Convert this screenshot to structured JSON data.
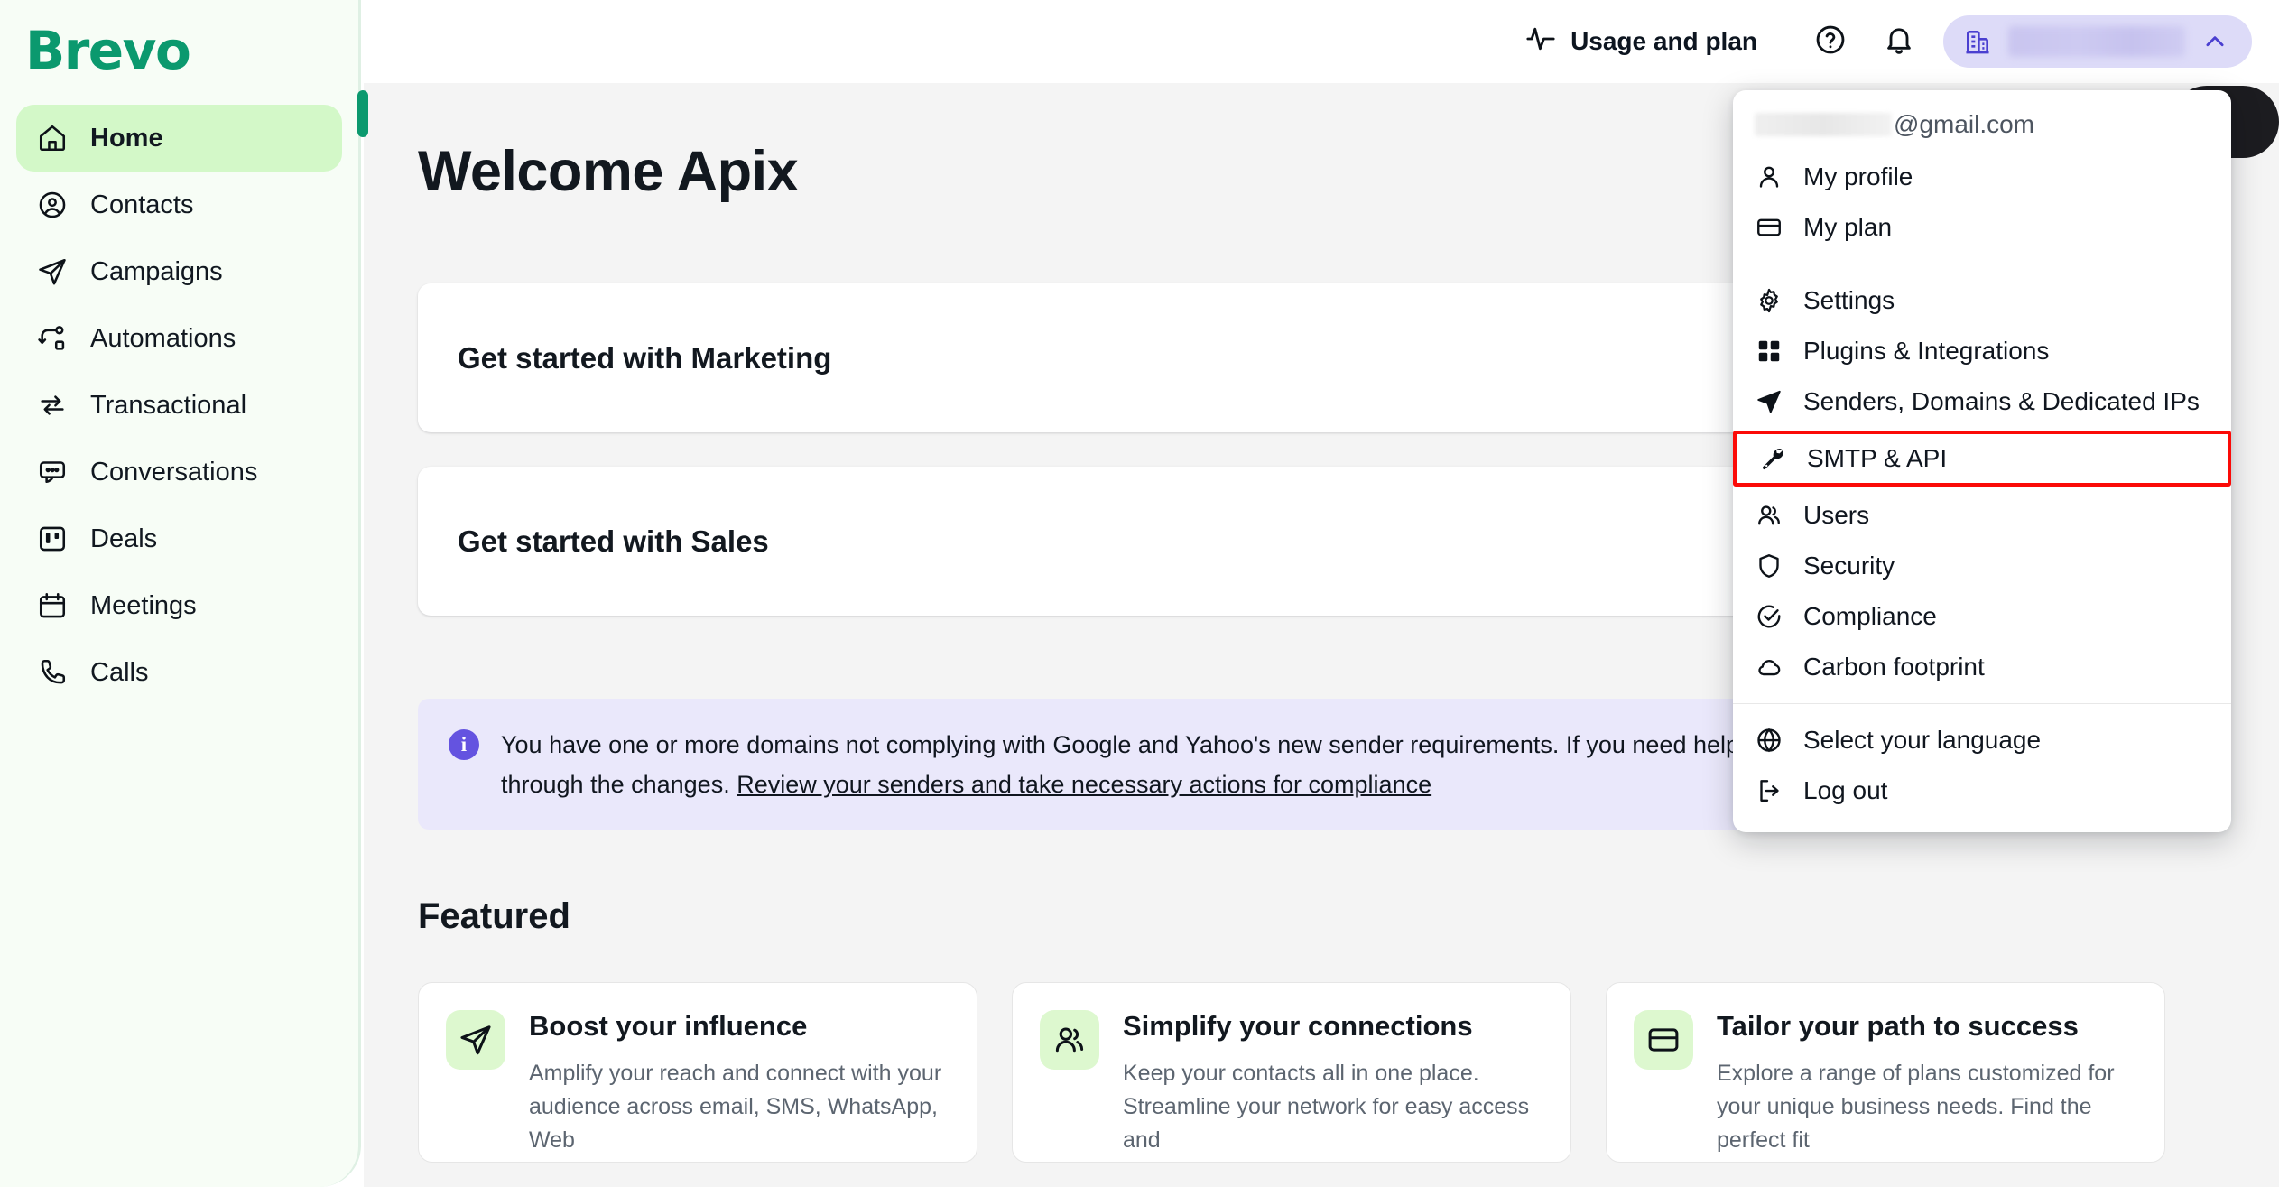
{
  "sidebar": {
    "brand": "Brevo",
    "items": [
      {
        "label": "Home",
        "icon": "home-icon",
        "active": true
      },
      {
        "label": "Contacts",
        "icon": "contacts-icon",
        "active": false
      },
      {
        "label": "Campaigns",
        "icon": "campaigns-send-icon",
        "active": false
      },
      {
        "label": "Automations",
        "icon": "automations-icon",
        "active": false
      },
      {
        "label": "Transactional",
        "icon": "transactional-sync-icon",
        "active": false
      },
      {
        "label": "Conversations",
        "icon": "conversations-chat-icon",
        "active": false
      },
      {
        "label": "Deals",
        "icon": "deals-board-icon",
        "active": false
      },
      {
        "label": "Meetings",
        "icon": "meetings-calendar-icon",
        "active": false
      },
      {
        "label": "Calls",
        "icon": "calls-phone-icon",
        "active": false
      }
    ]
  },
  "header": {
    "usage_label": "Usage and plan",
    "usage_icon": "activity-pulse-icon",
    "help_icon": "help-circle-icon",
    "notifications_icon": "bell-icon",
    "account_icon": "building-icon",
    "account_name_redacted": "",
    "account_chevron_icon": "chevron-up-icon",
    "accent_purple": "#5a4fd6",
    "chip_background": "#dddbf8"
  },
  "main": {
    "welcome_title": "Welcome Apix",
    "get_started": [
      {
        "title": "Get started with Marketing"
      },
      {
        "title": "Get started with Sales"
      }
    ],
    "banner": {
      "icon": "info-icon",
      "text_part_1": "You have one or more domains not complying with Google and Yahoo's new sender requirements. If you need help,",
      "text_part_2": "we're here to guide you through the changes.",
      "link_text": "Review your senders and take necessary actions for compliance",
      "background": "#eae8fb",
      "icon_color": "#6453e0"
    },
    "featured_heading": "Featured",
    "featured_cards": [
      {
        "icon": "send-icon",
        "title": "Boost your influence",
        "description": "Amplify your reach and connect with your audience across email, SMS, WhatsApp, Web"
      },
      {
        "icon": "people-icon",
        "title": "Simplify your connections",
        "description": "Keep your contacts all in one place. Streamline your network for easy access and"
      },
      {
        "icon": "card-icon",
        "title": "Tailor your path to success",
        "description": "Explore a range of plans customized for your unique business needs. Find the perfect fit"
      }
    ]
  },
  "account_menu": {
    "email_domain": "@gmail.com",
    "highlight_color": "#fb0a07",
    "groups": [
      {
        "items": [
          {
            "label": "My profile",
            "icon": "person-icon",
            "highlighted": false
          },
          {
            "label": "My plan",
            "icon": "credit-card-icon",
            "highlighted": false
          }
        ]
      },
      {
        "items": [
          {
            "label": "Settings",
            "icon": "gear-icon",
            "highlighted": false
          },
          {
            "label": "Plugins & Integrations",
            "icon": "grid-icon",
            "highlighted": false
          },
          {
            "label": "Senders, Domains & Dedicated IPs",
            "icon": "send-icon",
            "highlighted": false
          },
          {
            "label": "SMTP & API",
            "icon": "wrench-icon",
            "highlighted": true
          },
          {
            "label": "Users",
            "icon": "people-icon",
            "highlighted": false
          },
          {
            "label": "Security",
            "icon": "shield-icon",
            "highlighted": false
          },
          {
            "label": "Compliance",
            "icon": "check-circle-icon",
            "highlighted": false
          },
          {
            "label": "Carbon footprint",
            "icon": "cloud-icon",
            "highlighted": false
          }
        ]
      },
      {
        "items": [
          {
            "label": "Select your language",
            "icon": "globe-icon",
            "highlighted": false
          },
          {
            "label": "Log out",
            "icon": "logout-icon",
            "highlighted": false
          }
        ]
      }
    ]
  }
}
